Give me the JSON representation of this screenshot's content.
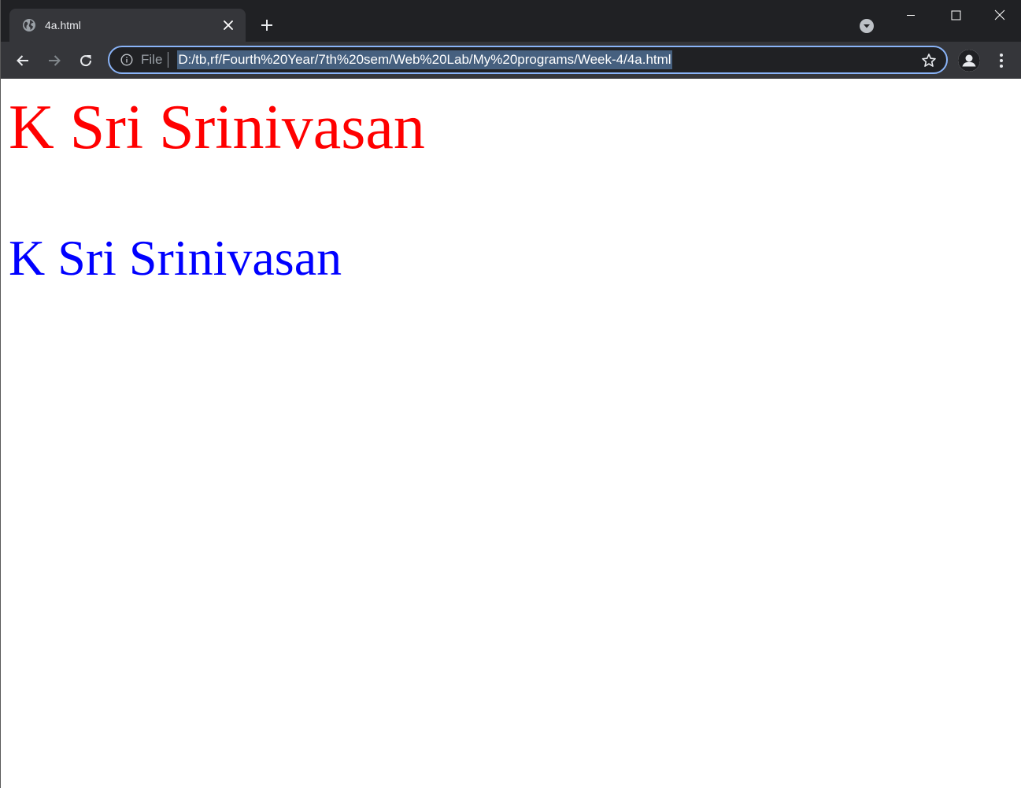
{
  "browser": {
    "tab": {
      "title": "4a.html"
    },
    "omnibox": {
      "scheme_label": "File",
      "url": "D:/tb,rf/Fourth%20Year/7th%20sem/Web%20Lab/My%20programs/Week-4/4a.html"
    },
    "icons": {
      "favicon": "globe-icon",
      "tab_close": "close-icon",
      "new_tab": "plus-icon",
      "tab_search": "chevron-down-icon",
      "minimize": "minimize-icon",
      "maximize": "maximize-icon",
      "close_window": "close-icon",
      "back": "arrow-left-icon",
      "forward": "arrow-right-icon",
      "reload": "reload-icon",
      "site_info": "info-icon",
      "bookmark": "star-icon",
      "profile": "person-icon",
      "menu": "kebab-menu-icon"
    }
  },
  "page": {
    "heading_red": {
      "text": "K Sri Srinivasan",
      "color": "#ff0000"
    },
    "heading_blue": {
      "text": "K Sri Srinivasan",
      "color": "#0000ff"
    }
  },
  "colors": {
    "chrome_dark": "#202124",
    "toolbar": "#35363a",
    "accent_focus": "#8ab4f8",
    "selection": "#46607f"
  }
}
